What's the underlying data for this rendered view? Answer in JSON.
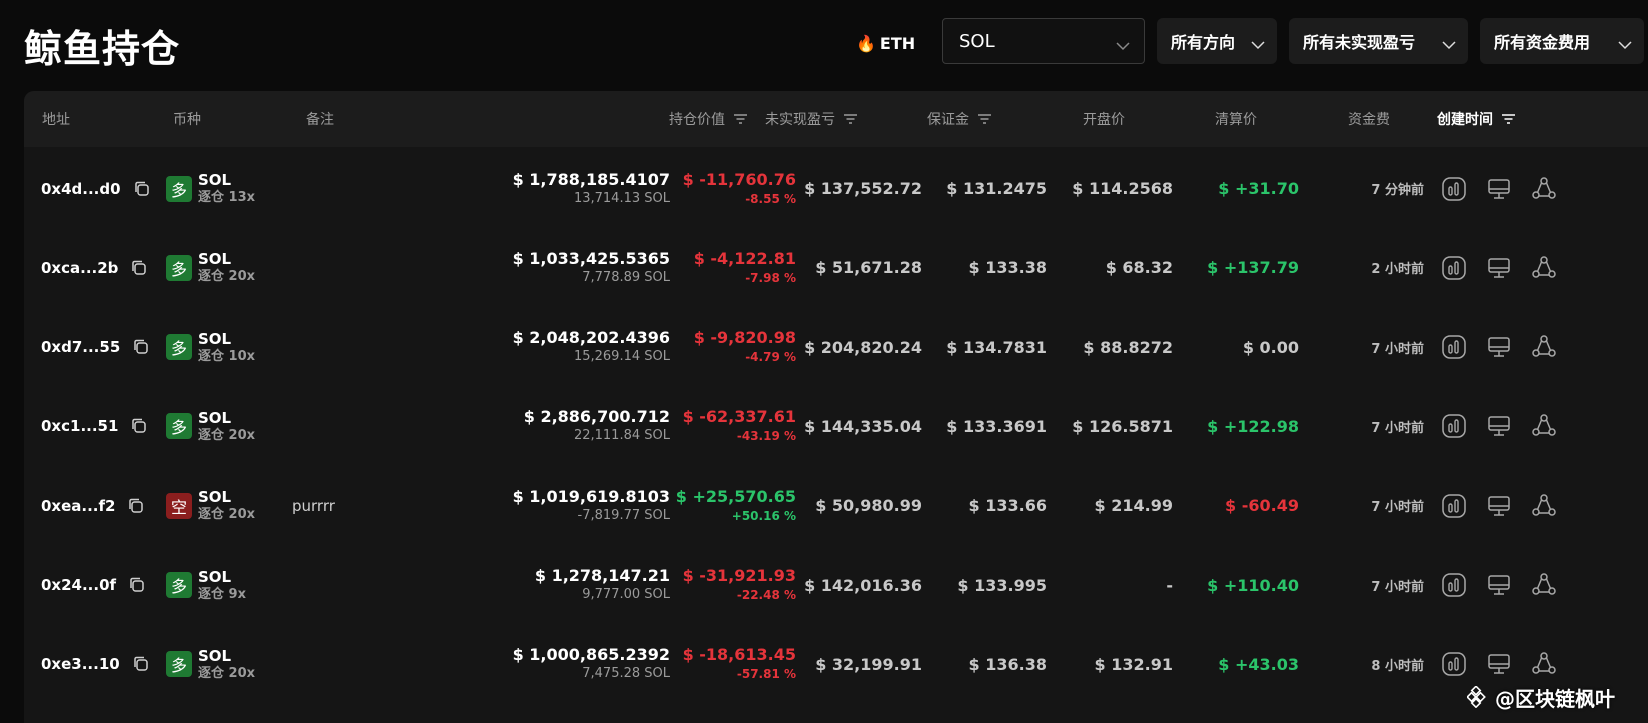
{
  "header": {
    "title": "鲸鱼持仓",
    "eth_label": "ETH",
    "fire_icon": "fire-icon",
    "coin_select": {
      "value": "SOL"
    },
    "filters": [
      {
        "label": "所有方向"
      },
      {
        "label": "所有未实现盈亏"
      },
      {
        "label": "所有资金费用"
      }
    ]
  },
  "table": {
    "columns": {
      "address": "地址",
      "coin": "币种",
      "note": "备注",
      "position_value": "持仓价值",
      "unrealized_pnl": "未实现盈亏",
      "margin": "保证金",
      "open_price": "开盘价",
      "liq_price": "清算价",
      "funding": "资金费",
      "created": "创建时间"
    },
    "rows": [
      {
        "address": "0x4d...d0",
        "side": "多",
        "side_type": "long",
        "coin": "SOL",
        "leverage": "逐仓 13x",
        "note": "",
        "value": "$ 1,788,185.4107",
        "size": "13,714.13 SOL",
        "pnl": "$ -11,760.76",
        "pnl_pct": "-8.55 %",
        "pnl_dir": "neg",
        "margin": "$ 137,552.72",
        "open": "$ 131.2475",
        "liq": "$ 114.2568",
        "funding": "$ +31.70",
        "funding_dir": "pos",
        "time": "7 分钟前"
      },
      {
        "address": "0xca...2b",
        "side": "多",
        "side_type": "long",
        "coin": "SOL",
        "leverage": "逐仓 20x",
        "note": "",
        "value": "$ 1,033,425.5365",
        "size": "7,778.89 SOL",
        "pnl": "$ -4,122.81",
        "pnl_pct": "-7.98 %",
        "pnl_dir": "neg",
        "margin": "$ 51,671.28",
        "open": "$ 133.38",
        "liq": "$ 68.32",
        "funding": "$ +137.79",
        "funding_dir": "pos",
        "time": "2 小时前"
      },
      {
        "address": "0xd7...55",
        "side": "多",
        "side_type": "long",
        "coin": "SOL",
        "leverage": "逐仓 10x",
        "note": "",
        "value": "$ 2,048,202.4396",
        "size": "15,269.14 SOL",
        "pnl": "$ -9,820.98",
        "pnl_pct": "-4.79 %",
        "pnl_dir": "neg",
        "margin": "$ 204,820.24",
        "open": "$ 134.7831",
        "liq": "$ 88.8272",
        "funding": "$ 0.00",
        "funding_dir": "zero",
        "time": "7 小时前"
      },
      {
        "address": "0xc1...51",
        "side": "多",
        "side_type": "long",
        "coin": "SOL",
        "leverage": "逐仓 20x",
        "note": "",
        "value": "$ 2,886,700.712",
        "size": "22,111.84 SOL",
        "pnl": "$ -62,337.61",
        "pnl_pct": "-43.19 %",
        "pnl_dir": "neg",
        "margin": "$ 144,335.04",
        "open": "$ 133.3691",
        "liq": "$ 126.5871",
        "funding": "$ +122.98",
        "funding_dir": "pos",
        "time": "7 小时前"
      },
      {
        "address": "0xea...f2",
        "side": "空",
        "side_type": "short",
        "coin": "SOL",
        "leverage": "逐仓 20x",
        "note": "purrrr",
        "value": "$ 1,019,619.8103",
        "size": "-7,819.77 SOL",
        "pnl": "$ +25,570.65",
        "pnl_pct": "+50.16 %",
        "pnl_dir": "pos",
        "margin": "$ 50,980.99",
        "open": "$ 133.66",
        "liq": "$ 214.99",
        "funding": "$ -60.49",
        "funding_dir": "neg",
        "time": "7 小时前"
      },
      {
        "address": "0x24...0f",
        "side": "多",
        "side_type": "long",
        "coin": "SOL",
        "leverage": "逐仓 9x",
        "note": "",
        "value": "$ 1,278,147.21",
        "size": "9,777.00 SOL",
        "pnl": "$ -31,921.93",
        "pnl_pct": "-22.48 %",
        "pnl_dir": "neg",
        "margin": "$ 142,016.36",
        "open": "$ 133.995",
        "liq": "-",
        "funding": "$ +110.40",
        "funding_dir": "pos",
        "time": "7 小时前"
      },
      {
        "address": "0xe3...10",
        "side": "多",
        "side_type": "long",
        "coin": "SOL",
        "leverage": "逐仓 20x",
        "note": "",
        "value": "$ 1,000,865.2392",
        "size": "7,475.28 SOL",
        "pnl": "$ -18,613.45",
        "pnl_pct": "-57.81 %",
        "pnl_dir": "neg",
        "margin": "$ 32,199.91",
        "open": "$ 136.38",
        "liq": "$ 132.91",
        "funding": "$ +43.03",
        "funding_dir": "pos",
        "time": "8 小时前"
      }
    ],
    "row_actions": [
      "chart-icon",
      "monitor-icon",
      "share-icon"
    ]
  },
  "colors": {
    "positive": "#2bc46a",
    "negative": "#e5343b",
    "long_badge": "#1f7a33",
    "short_badge": "#8b1e1e"
  },
  "watermark": {
    "text": "@区块链枫叶"
  }
}
